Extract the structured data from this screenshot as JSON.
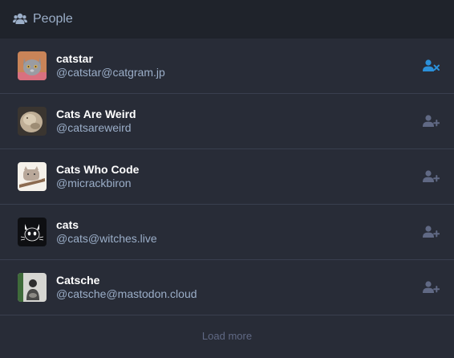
{
  "header": {
    "title": "People",
    "icon": "users-icon"
  },
  "colors": {
    "accent": "#2b90d9",
    "muted_icon": "#606984",
    "header_text": "#9baec8"
  },
  "people": [
    {
      "display_name": "catstar",
      "acct": "@catstar@catgram.jp",
      "action": "unfollow",
      "action_icon": "user-times-icon"
    },
    {
      "display_name": "Cats Are Weird",
      "acct": "@catsareweird",
      "action": "follow",
      "action_icon": "user-plus-icon"
    },
    {
      "display_name": "Cats Who Code",
      "acct": "@micrackbiron",
      "action": "follow",
      "action_icon": "user-plus-icon"
    },
    {
      "display_name": "cats",
      "acct": "@cats@witches.live",
      "action": "follow",
      "action_icon": "user-plus-icon"
    },
    {
      "display_name": "Catsche",
      "acct": "@catsche@mastodon.cloud",
      "action": "follow",
      "action_icon": "user-plus-icon"
    }
  ],
  "load_more_label": "Load more"
}
